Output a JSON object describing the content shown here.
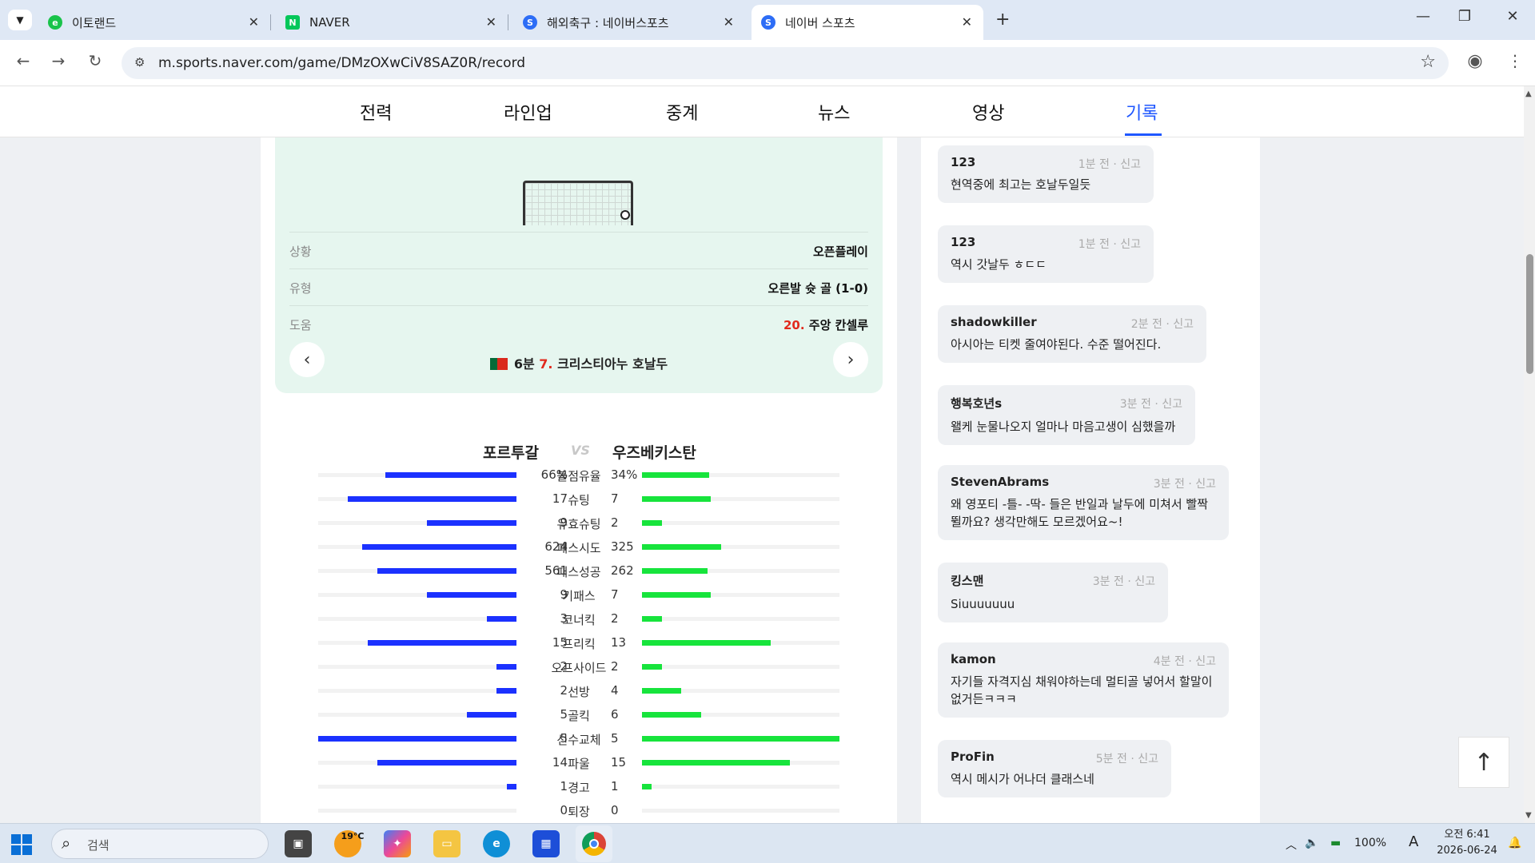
{
  "browser": {
    "tabs": [
      {
        "title": "이토랜드",
        "icon_color": "#19c34a",
        "icon_char": "e"
      },
      {
        "title": "NAVER",
        "icon_color": "#03c75a",
        "icon_char": "N"
      },
      {
        "title": "해외축구 : 네이버스포츠",
        "icon_color": "#2d6df6",
        "icon_char": "S"
      },
      {
        "title": "네이버 스포츠",
        "icon_color": "#2d6df6",
        "icon_char": "S"
      }
    ],
    "url": "m.sports.naver.com/game/DMzOXwCiV8SAZ0R/record"
  },
  "gnb": [
    "전력",
    "라인업",
    "중계",
    "뉴스",
    "영상",
    "기록"
  ],
  "goal": {
    "rows": [
      {
        "key": "상황",
        "value": "오픈플레이"
      },
      {
        "key": "유형",
        "value": "오른발 슛 골 (1-0)"
      },
      {
        "key": "도움",
        "num": "20.",
        "value": "주앙 칸셀루"
      }
    ],
    "scorer_min": "6분",
    "scorer_num": "7.",
    "scorer_name": "크리스티아누 호날두"
  },
  "stats": {
    "home": "포르투갈",
    "away": "우즈베키스탄",
    "vs": "VS",
    "rows": [
      {
        "label": "볼점유율",
        "home": "66%",
        "away": "34%",
        "h": 0.66,
        "a": 0.34
      },
      {
        "label": "슈팅",
        "home": "17",
        "away": "7",
        "h": 0.85,
        "a": 0.35
      },
      {
        "label": "유효슈팅",
        "home": "9",
        "away": "2",
        "h": 0.45,
        "a": 0.1
      },
      {
        "label": "패스시도",
        "home": "624",
        "away": "325",
        "h": 0.78,
        "a": 0.4
      },
      {
        "label": "패스성공",
        "home": "561",
        "away": "262",
        "h": 0.7,
        "a": 0.33
      },
      {
        "label": "키패스",
        "home": "9",
        "away": "7",
        "h": 0.45,
        "a": 0.35
      },
      {
        "label": "코너킥",
        "home": "3",
        "away": "2",
        "h": 0.15,
        "a": 0.1
      },
      {
        "label": "프리킥",
        "home": "15",
        "away": "13",
        "h": 0.75,
        "a": 0.65
      },
      {
        "label": "오프사이드",
        "home": "2",
        "away": "2",
        "h": 0.1,
        "a": 0.1
      },
      {
        "label": "선방",
        "home": "2",
        "away": "4",
        "h": 0.1,
        "a": 0.2
      },
      {
        "label": "골킥",
        "home": "5",
        "away": "6",
        "h": 0.25,
        "a": 0.3
      },
      {
        "label": "선수교체",
        "home": "5",
        "away": "5",
        "h": 1.0,
        "a": 1.0
      },
      {
        "label": "파울",
        "home": "14",
        "away": "15",
        "h": 0.7,
        "a": 0.75
      },
      {
        "label": "경고",
        "home": "1",
        "away": "1",
        "h": 0.05,
        "a": 0.05
      },
      {
        "label": "퇴장",
        "home": "0",
        "away": "0",
        "h": 0,
        "a": 0
      }
    ]
  },
  "comments": [
    {
      "user": "123",
      "meta": "1분 전 · 신고",
      "text": "현역중에 최고는 호날두일듯"
    },
    {
      "user": "123",
      "meta": "1분 전 · 신고",
      "text": "역시 갓날두 ㅎㄷㄷ"
    },
    {
      "user": "shadowkiller",
      "meta": "2분 전 · 신고",
      "text": "아시아는 티켓 줄여야된다. 수준 떨어진다."
    },
    {
      "user": "행복호년s",
      "meta": "3분 전 · 신고",
      "text": "왤케 눈물나오지 얼마나 마음고생이 심했을까"
    },
    {
      "user": "StevenAbrams",
      "meta": "3분 전 · 신고",
      "text": "왜 영포티 -틀- -딱- 들은 반일과 날두에 미쳐서 빨짝 뛸까요? 생각만해도 모르겠어요~!"
    },
    {
      "user": "킹스맨",
      "meta": "3분 전 · 신고",
      "text": "Siuuuuuuu"
    },
    {
      "user": "kamon",
      "meta": "4분 전 · 신고",
      "text": "자기들 자격지심 채워야하는데 멀티골 넣어서 할말이 없거든ㅋㅋㅋ"
    },
    {
      "user": "ProFin",
      "meta": "5분 전 · 신고",
      "text": "역시 메시가 어나더 클래스네"
    }
  ],
  "taskbar": {
    "search_placeholder": "검색",
    "weather": "19°C",
    "battery": "100%",
    "ime": "A",
    "time": "오전 6:41",
    "date": "2026-06-24"
  }
}
